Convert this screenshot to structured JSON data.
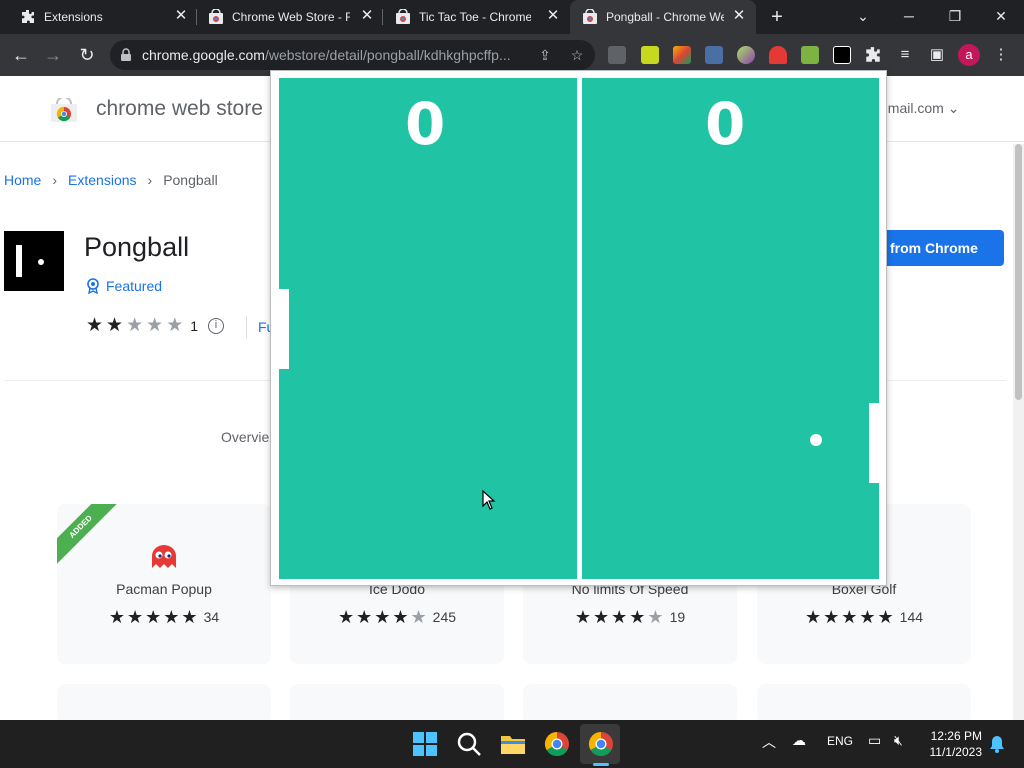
{
  "browser": {
    "tabs": [
      {
        "title": "Extensions",
        "icon": "puzzle-icon",
        "active": false
      },
      {
        "title": "Chrome Web Store - R",
        "icon": "webstore-icon",
        "active": false
      },
      {
        "title": "Tic Tac Toe - Chrome W",
        "icon": "webstore-icon",
        "active": false
      },
      {
        "title": "Pongball - Chrome We",
        "icon": "webstore-icon",
        "active": true
      }
    ],
    "new_tab_label": "+",
    "url_host": "chrome.google.com",
    "url_path": "/webstore/detail/pongball/kdhkghpcffp...",
    "avatar_letter": "a",
    "colors": {
      "tabstrip": "#202124",
      "toolbar": "#35363a",
      "accent": "#1a73e8"
    }
  },
  "store": {
    "header_title": "chrome web store",
    "account": "gmail.com",
    "breadcrumb": {
      "home": "Home",
      "extensions": "Extensions",
      "current": "Pongball"
    },
    "app_name": "Pongball",
    "featured_label": "Featured",
    "rating_stars": 2,
    "rating_count": "1",
    "fu_link": "Fu",
    "remove_button": "from Chrome",
    "overview_tab": "Overvie",
    "related": [
      {
        "name": "Pacman Popup",
        "stars": 5,
        "count": "34",
        "added": true,
        "added_label": "ADDED"
      },
      {
        "name": "Ice Dodo",
        "stars": 4.5,
        "count": "245",
        "added": false
      },
      {
        "name": "No limits Of Speed",
        "stars": 4.5,
        "count": "19",
        "added": false
      },
      {
        "name": "Boxel Golf",
        "stars": 5,
        "count": "144",
        "added": false
      }
    ]
  },
  "game": {
    "left_score": "0",
    "right_score": "0",
    "court_color": "#20c4a5"
  },
  "taskbar": {
    "language": "ENG",
    "time": "12:26 PM",
    "date": "11/1/2023"
  }
}
